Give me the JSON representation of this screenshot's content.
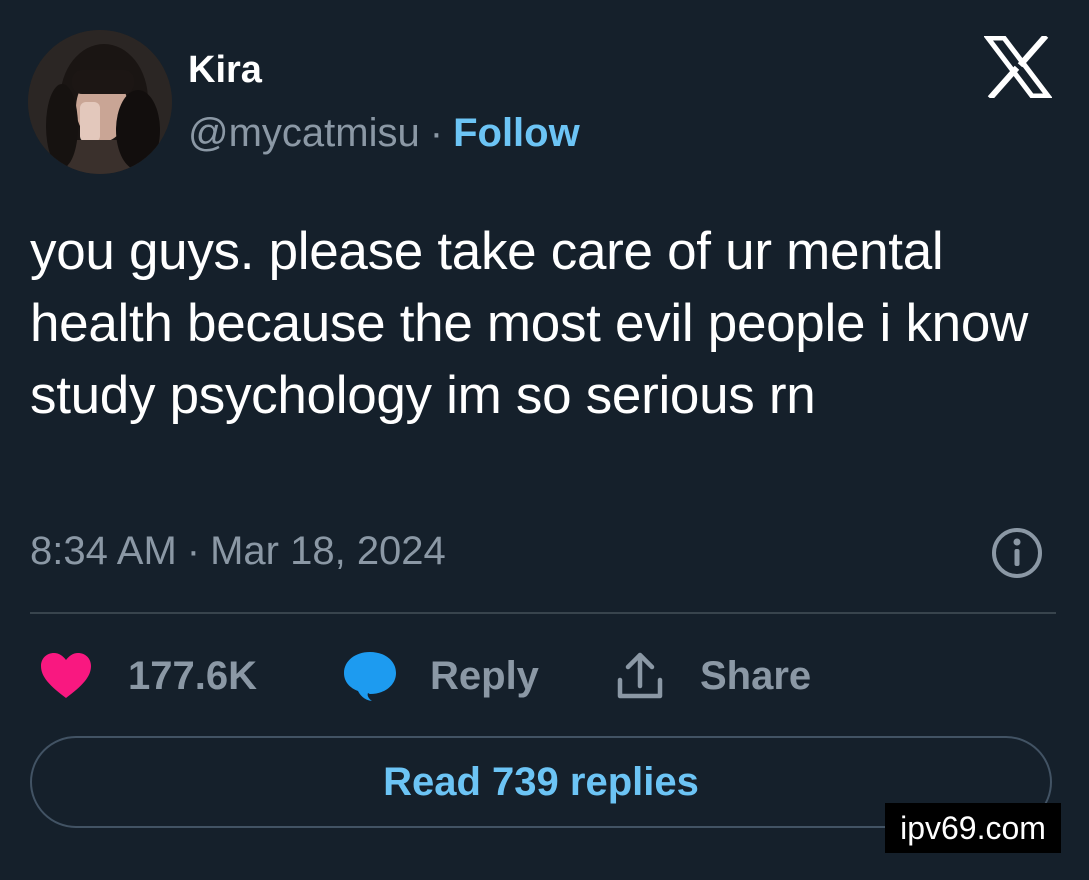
{
  "author": {
    "display_name": "Kira",
    "handle": "@mycatmisu",
    "separator": "·",
    "follow_label": "Follow"
  },
  "tweet": {
    "text": "you guys. please take care of ur mental health because the most evil people i know study psychology im so serious rn",
    "time": "8:34 AM",
    "separator": "·",
    "date": "Mar 18, 2024"
  },
  "actions": {
    "like_count": "177.6K",
    "reply_label": "Reply",
    "share_label": "Share"
  },
  "read_replies_label": "Read 739 replies",
  "watermark": "ipv69.com",
  "icons": {
    "logo": "x-logo-icon",
    "info": "info-icon",
    "like": "heart-icon",
    "reply": "speech-bubble-icon",
    "share": "share-upload-icon"
  },
  "colors": {
    "background": "#15202b",
    "accent": "#6cc4f5",
    "heart": "#f91880",
    "reply_bubble": "#1d9bf0",
    "muted_text": "#8b98a5"
  }
}
